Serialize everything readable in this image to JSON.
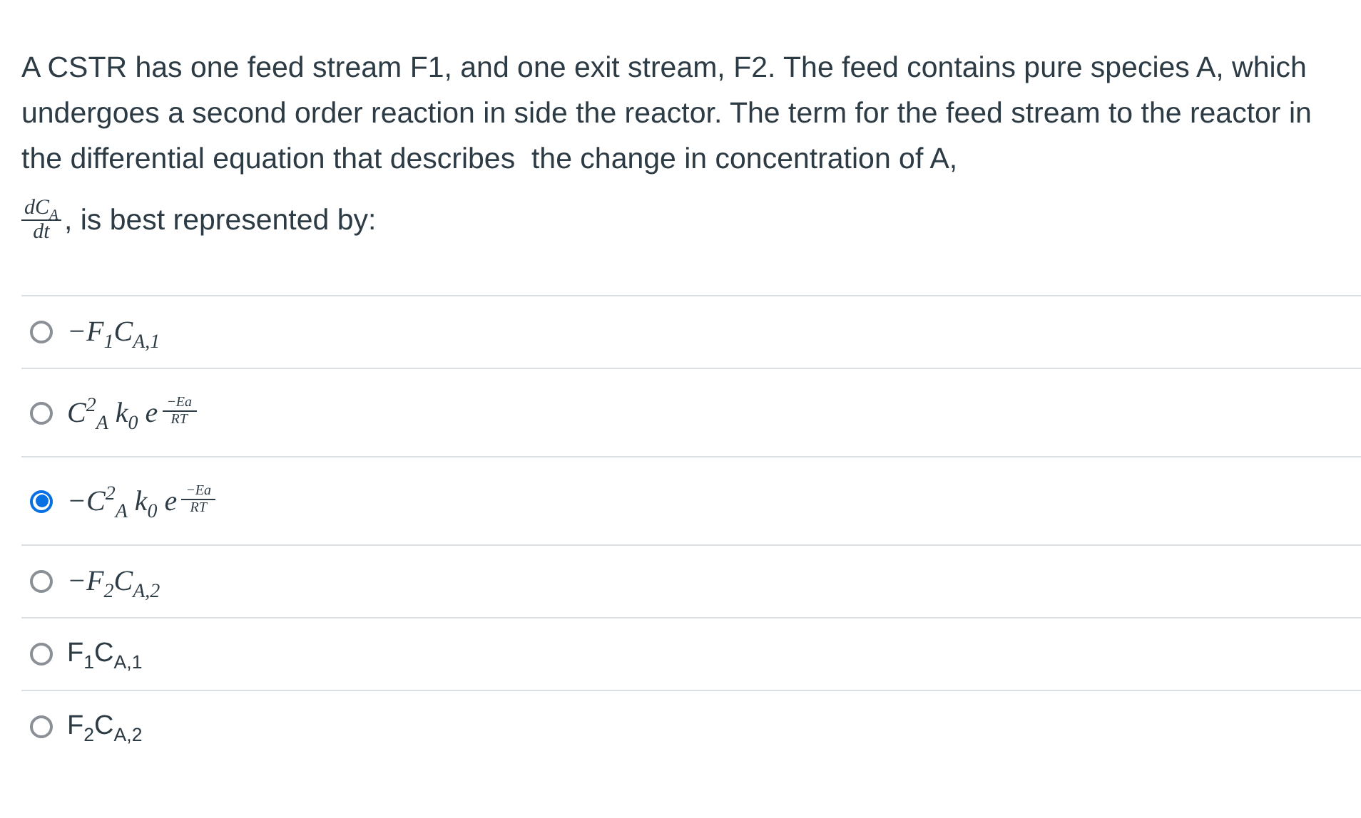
{
  "question": {
    "text": "A CSTR has one feed stream F1, and one exit stream, F2. The feed contains pure species A, which undergoes a second order reaction in side the reactor. The term for the feed stream to the reactor in the differential equation that describes  the change in concentration of A,",
    "fraction": {
      "numerator": "dC$_{A}$",
      "denominator": "dt"
    },
    "text_after": ", is best represented by:"
  },
  "options": [
    {
      "kind": "formula",
      "label": "−F$_{1}$C$_{A,1}$",
      "selected": false
    },
    {
      "kind": "arrhenius",
      "label": "C$^{2}$$_{A}$ k$_{0}$ e",
      "exponent_numerator": "−Ea",
      "exponent_denominator": "RT",
      "selected": false
    },
    {
      "kind": "arrhenius",
      "label": "−C$^{2}$$_{A}$ k$_{0}$ e",
      "exponent_numerator": "−Ea",
      "exponent_denominator": "RT",
      "selected": true
    },
    {
      "kind": "formula",
      "label": "−F$_{2}$C$_{A,2}$",
      "selected": false
    },
    {
      "kind": "plain",
      "label": "F$_{1}$C$_{A,1}$",
      "selected": false
    },
    {
      "kind": "plain",
      "label": "F$_{2}$C$_{A,2}$",
      "selected": false
    }
  ]
}
